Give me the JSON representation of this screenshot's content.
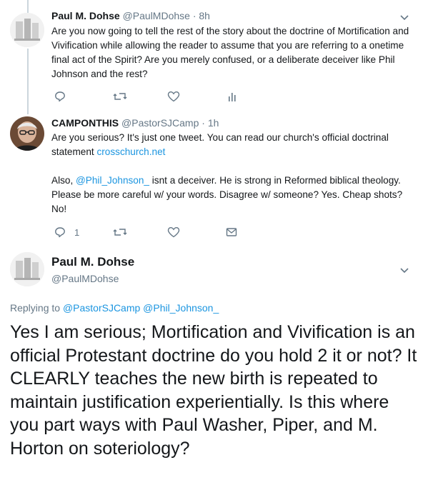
{
  "tweets": [
    {
      "name": "Paul M. Dohse",
      "handle": "@PaulMDohse",
      "time": "· 8h",
      "text": "Are you now going to tell the rest of the story about the doctrine of Mortification and Vivification while allowing the reader to assume that you are referring to a onetime final act of the Spirit? Are you merely confused, or a deliberate deceiver like Phil Johnson and the rest?"
    },
    {
      "name": "CAMPONTHIS",
      "handle": "@PastorSJCamp",
      "time": "· 1h",
      "text_part1": "Are you serious? It's just one tweet. You can read our church's official doctrinal statement ",
      "link": "crosschurch.net",
      "text_part2_prefix": "Also, ",
      "mention": "@Phil_Johnson_",
      "text_part2": " isnt a deceiver. He is strong in Reformed biblical theology. Please be more careful w/ your words. Disagree w/ someone? Yes. Cheap shots? No!",
      "reply_count": "1"
    }
  ],
  "main_tweet": {
    "name": "Paul M. Dohse",
    "handle": "@PaulMDohse",
    "replying_prefix": "Replying to ",
    "replying_to": "@PastorSJCamp @Phil_Johnson_",
    "text": "Yes I am serious; Mortification and Vivification is an official Protestant doctrine do you hold 2 it or not? It CLEARLY teaches the new birth is repeated to maintain justification experientially. Is this where you part ways with Paul Washer, Piper, and M. Horton on soteriology?"
  },
  "colors": {
    "link": "#1b95e0",
    "muted": "#657786",
    "thread_line": "#ccd6dd"
  }
}
